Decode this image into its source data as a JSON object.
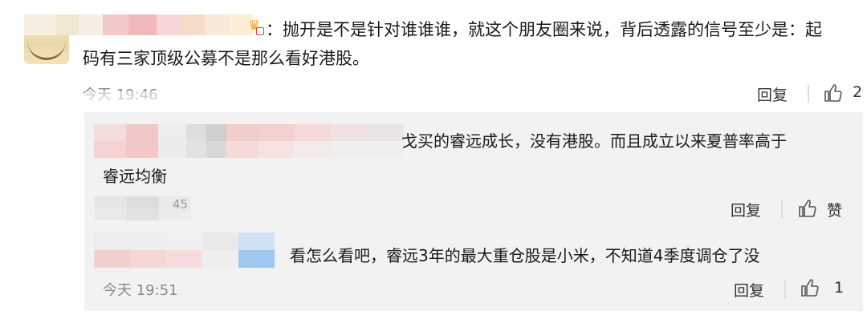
{
  "main_comment": {
    "text_line1": "：抛开是不是针对谁谁谁，就这个朋友圈来说，背后透露的信号至少是：起",
    "text_line2": "码有三家顶级公募不是那么看好港股。",
    "time": "今天 19:46",
    "reply_label": "回复",
    "like_count": "2"
  },
  "replies": [
    {
      "text_line1": "戈买的睿远成长，没有港股。而且成立以来夏普率高于",
      "text_line2": "睿远均衡",
      "time_partial": "45",
      "reply_label": "回复",
      "like_label": "赞"
    },
    {
      "text_line1": "看怎么看吧，睿远3年的最大重仓股是小米，不知道4季度调仓了没",
      "time": "今天 19:51",
      "reply_label": "回复",
      "like_count": "1"
    }
  ],
  "colors": {
    "reply_bg": "#f2f2f2",
    "muted_text": "#8a8a8a",
    "badge_gold": "#f3a623"
  },
  "icons": [
    "thumbs-up-icon",
    "vip-crown-icon"
  ]
}
